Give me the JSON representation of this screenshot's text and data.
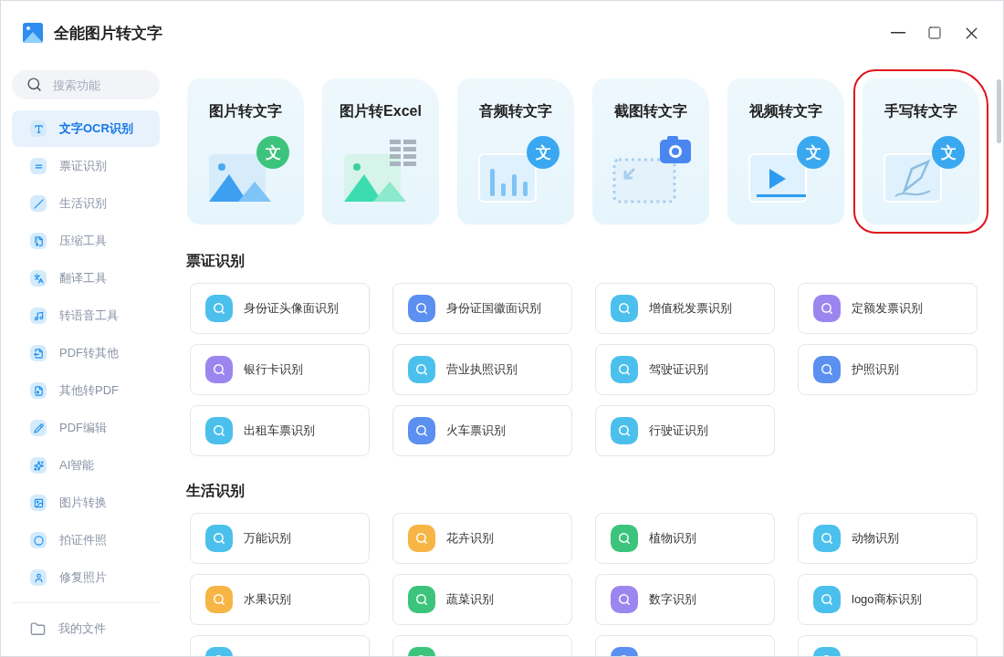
{
  "window": {
    "title": "全能图片转文字"
  },
  "sidebar": {
    "search": {
      "placeholder": "搜索功能"
    },
    "items": [
      {
        "label": "文字OCR识别",
        "selected": true
      },
      {
        "label": "票证识别",
        "selected": false
      },
      {
        "label": "生活识别",
        "selected": false
      },
      {
        "label": "压缩工具",
        "selected": false
      },
      {
        "label": "翻译工具",
        "selected": false
      },
      {
        "label": "转语音工具",
        "selected": false
      },
      {
        "label": "PDF转其他",
        "selected": false
      },
      {
        "label": "其他转PDF",
        "selected": false
      },
      {
        "label": "PDF编辑",
        "selected": false
      },
      {
        "label": "AI智能",
        "selected": false
      },
      {
        "label": "图片转换",
        "selected": false
      },
      {
        "label": "拍证件照",
        "selected": false
      },
      {
        "label": "修复照片",
        "selected": false
      }
    ],
    "footer": {
      "label": "我的文件"
    }
  },
  "feature_cards": [
    {
      "label": "图片转文字",
      "kind": "image",
      "badge": "文",
      "color": "#3cc47c",
      "highlighted": false
    },
    {
      "label": "图片转Excel",
      "kind": "excel",
      "highlighted": false
    },
    {
      "label": "音频转文字",
      "kind": "audio",
      "badge": "文",
      "color": "#3aa8f0",
      "highlighted": false
    },
    {
      "label": "截图转文字",
      "kind": "screenshot",
      "highlighted": false
    },
    {
      "label": "视频转文字",
      "kind": "video",
      "badge": "文",
      "color": "#3aa8f0",
      "highlighted": false
    },
    {
      "label": "手写转文字",
      "kind": "handwriting",
      "badge": "文",
      "color": "#3aa8f0",
      "highlighted": true
    }
  ],
  "sections": [
    {
      "title": "票证识别",
      "tools": [
        {
          "label": "身份证头像面识别",
          "color": "#4cc0ec"
        },
        {
          "label": "身份证国徽面识别",
          "color": "#5b8ff0"
        },
        {
          "label": "增值税发票识别",
          "color": "#4cc0ec"
        },
        {
          "label": "定额发票识别",
          "color": "#9b86f0"
        },
        {
          "label": "银行卡识别",
          "color": "#9b86f0"
        },
        {
          "label": "营业执照识别",
          "color": "#4cc0ec"
        },
        {
          "label": "驾驶证识别",
          "color": "#4cc0ec"
        },
        {
          "label": "护照识别",
          "color": "#5b8ff0"
        },
        {
          "label": "出租车票识别",
          "color": "#4cc0ec"
        },
        {
          "label": "火车票识别",
          "color": "#5b8ff0"
        },
        {
          "label": "行驶证识别",
          "color": "#4cc0ec"
        }
      ]
    },
    {
      "title": "生活识别",
      "tools": [
        {
          "label": "万能识别",
          "color": "#4cc0ec"
        },
        {
          "label": "花卉识别",
          "color": "#f6b545"
        },
        {
          "label": "植物识别",
          "color": "#3cc47c"
        },
        {
          "label": "动物识别",
          "color": "#4cc0ec"
        },
        {
          "label": "水果识别",
          "color": "#f6b545"
        },
        {
          "label": "蔬菜识别",
          "color": "#3cc47c"
        },
        {
          "label": "数字识别",
          "color": "#9b86f0"
        },
        {
          "label": "logo商标识别",
          "color": "#4cc0ec"
        },
        {
          "color": "#4cc0ec"
        },
        {
          "color": "#3cc47c"
        },
        {
          "color": "#5b8ff0"
        },
        {
          "color": "#4cc0ec"
        }
      ]
    }
  ]
}
